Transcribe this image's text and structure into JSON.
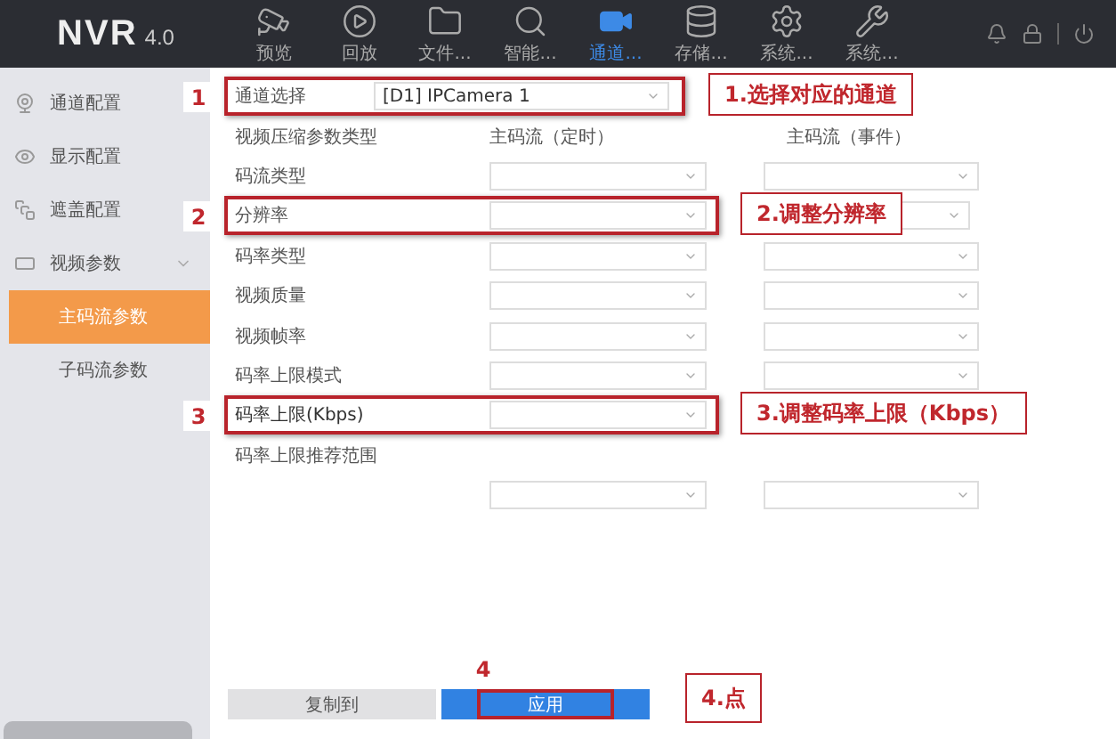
{
  "header": {
    "logo": "NVR",
    "version": "4.0"
  },
  "nav": [
    {
      "label": "预览",
      "selected": false
    },
    {
      "label": "回放",
      "selected": false
    },
    {
      "label": "文件...",
      "selected": false
    },
    {
      "label": "智能...",
      "selected": false
    },
    {
      "label": "通道...",
      "selected": true
    },
    {
      "label": "存储...",
      "selected": false
    },
    {
      "label": "系统...",
      "selected": false
    },
    {
      "label": "系统...",
      "selected": false
    }
  ],
  "sidebar": {
    "items": [
      {
        "label": "通道配置",
        "selected": false
      },
      {
        "label": "显示配置",
        "selected": false
      },
      {
        "label": "遮盖配置",
        "selected": false
      },
      {
        "label": "视频参数",
        "expanded": true,
        "selected": false,
        "children": [
          {
            "label": "主码流参数",
            "selected": true
          },
          {
            "label": "子码流参数",
            "selected": false
          }
        ]
      }
    ]
  },
  "channel_select": {
    "label": "通道选择",
    "value": "[D1] IPCamera 1",
    "annotation": {
      "step": "1",
      "callout": "1.选择对应的通道"
    }
  },
  "form": {
    "label": "视频压缩参数类型",
    "column_headers": [
      "主码流（定时）",
      "主码流（事件）"
    ],
    "rows": [
      {
        "label": "码流类型",
        "kind": "pair"
      },
      {
        "label": "分辨率",
        "kind": "pair",
        "annotation": {
          "step": "2",
          "callout": "2.调整分辨率"
        }
      },
      {
        "label": "码率类型",
        "kind": "pair"
      },
      {
        "label": "视频质量",
        "kind": "pair"
      },
      {
        "label": "视频帧率",
        "kind": "pair"
      },
      {
        "label": "码率上限模式",
        "kind": "pair"
      },
      {
        "label": "码率上限(Kbps)",
        "kind": "single",
        "annotation": {
          "step": "3",
          "callout": "3.调整码率上限（Kbps）"
        }
      },
      {
        "label": "码率上限推荐范围",
        "kind": "label"
      },
      {
        "kind": "pair"
      }
    ]
  },
  "buttons": [
    {
      "label": "复制到",
      "kind": "secondary"
    },
    {
      "label": "应用",
      "kind": "primary",
      "annotation": {
        "step": "4",
        "callout": "4.点"
      }
    }
  ]
}
